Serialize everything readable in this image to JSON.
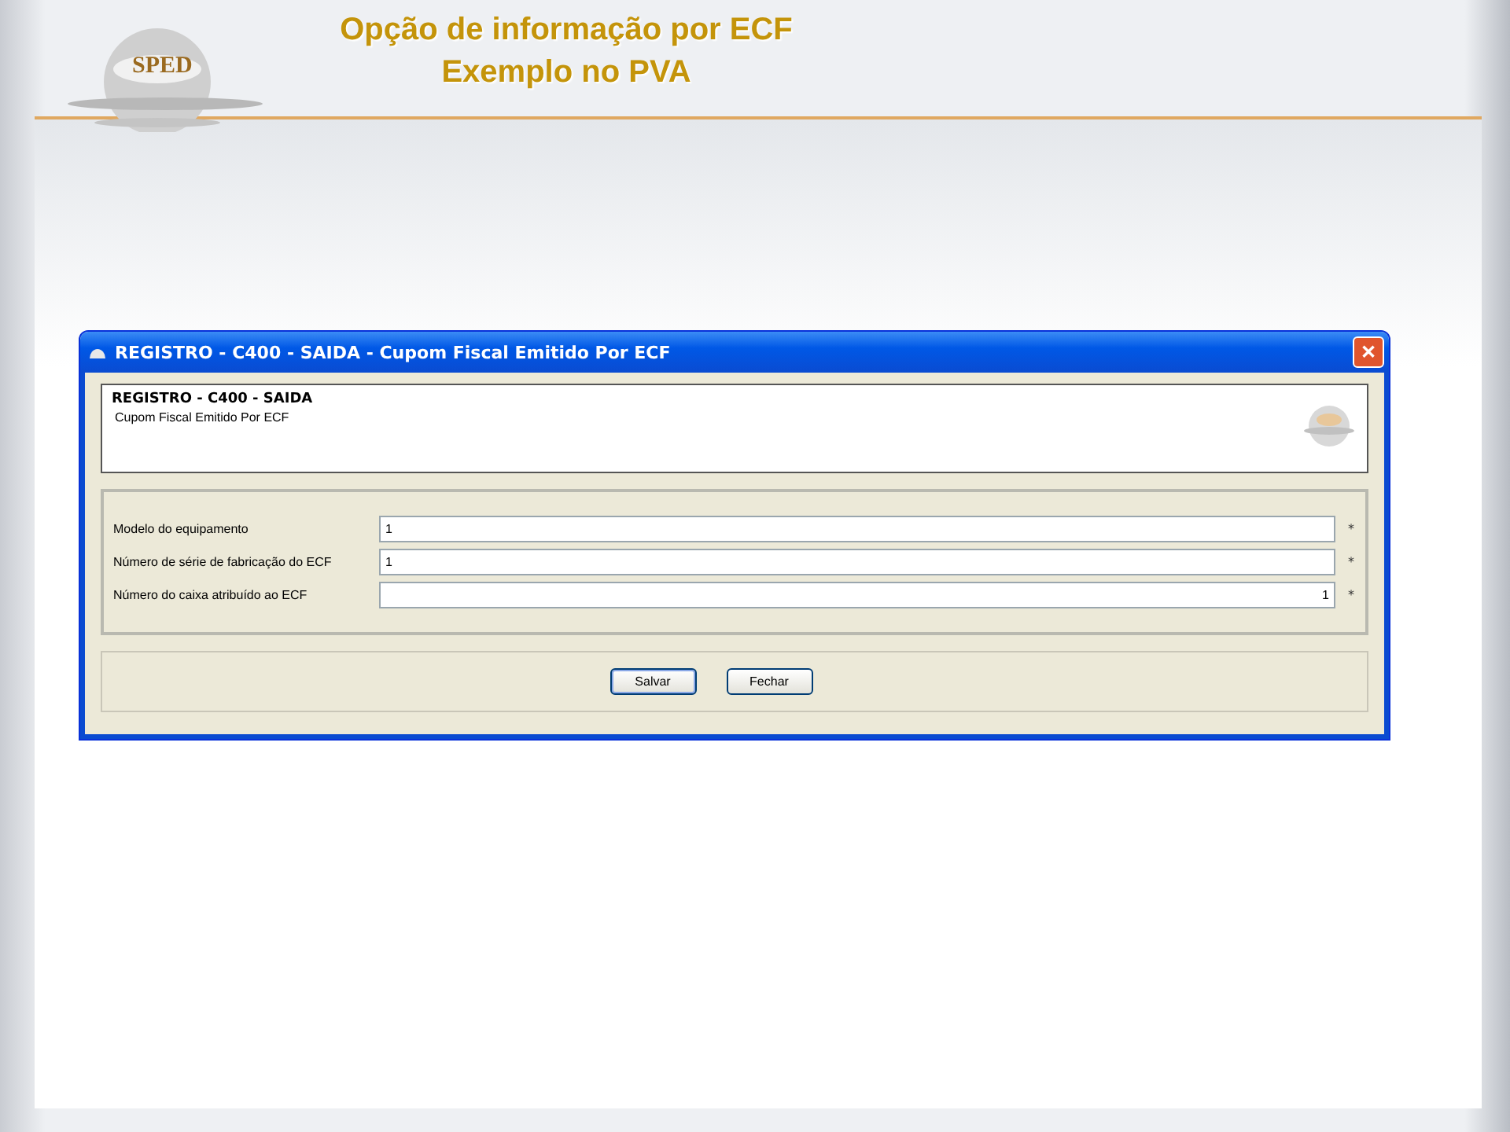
{
  "slide": {
    "title_lines": [
      "Opção de informação por ECF",
      "Exemplo no PVA"
    ],
    "logo_text": "SPED"
  },
  "window": {
    "title": "REGISTRO - C400 - SAIDA - Cupom Fiscal Emitido Por ECF",
    "close": "✕",
    "header": {
      "title": "REGISTRO - C400 - SAIDA",
      "subtitle": "Cupom Fiscal Emitido Por ECF"
    },
    "fields": [
      {
        "label": "Modelo do equipamento",
        "kind": "text",
        "value": "1",
        "required": "*"
      },
      {
        "label": "Número de série de fabricação do ECF",
        "kind": "text",
        "value": "1",
        "required": "*"
      },
      {
        "label": "Número do caixa atribuído ao ECF",
        "kind": "number",
        "value": "1",
        "required": "*"
      }
    ],
    "buttons": [
      {
        "label": "Salvar",
        "selected": true
      },
      {
        "label": "Fechar",
        "selected": false
      }
    ]
  }
}
